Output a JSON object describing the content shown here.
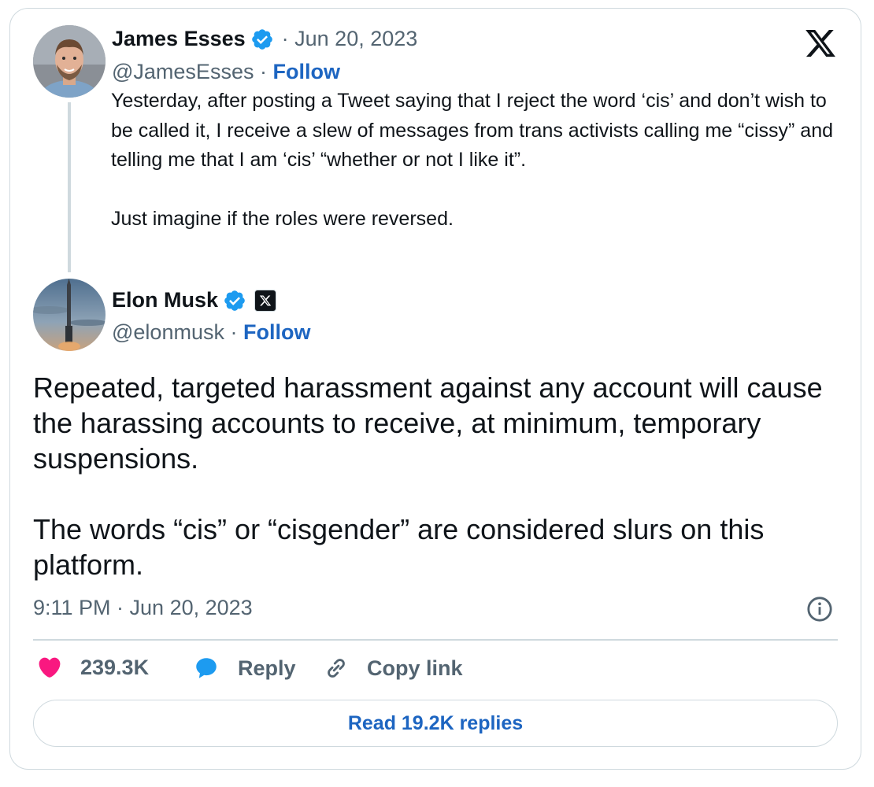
{
  "brand": {
    "logo_icon": "x-logo-icon",
    "link_color": "#1d65c1",
    "like_color": "#f91880",
    "verified_color": "#1d9bf0"
  },
  "quoted_tweet": {
    "author_name": "James Esses",
    "date": "· Jun 20, 2023",
    "handle": "@JamesEsses ·",
    "follow_label": "Follow",
    "paragraphs": [
      "Yesterday, after posting a Tweet saying that I reject the word ‘cis’ and don’t wish to be called it, I receive a slew of messages from trans activists calling me “cissy” and telling me that I am ‘cis’ “whether or not I like it”.",
      "Just imagine if the roles were reversed."
    ]
  },
  "main_tweet": {
    "author_name": "Elon Musk",
    "handle": "@elonmusk ·",
    "follow_label": "Follow",
    "paragraphs": [
      "Repeated, targeted harassment against any account will cause the harassing accounts to receive, at minimum, temporary suspensions.",
      "The words “cis” or “cisgender” are considered slurs on this platform."
    ],
    "timestamp": "9:11 PM · Jun 20, 2023"
  },
  "actions": {
    "likes": "239.3K",
    "reply_label": "Reply",
    "copy_link_label": "Copy link",
    "read_replies_label": "Read 19.2K replies"
  }
}
